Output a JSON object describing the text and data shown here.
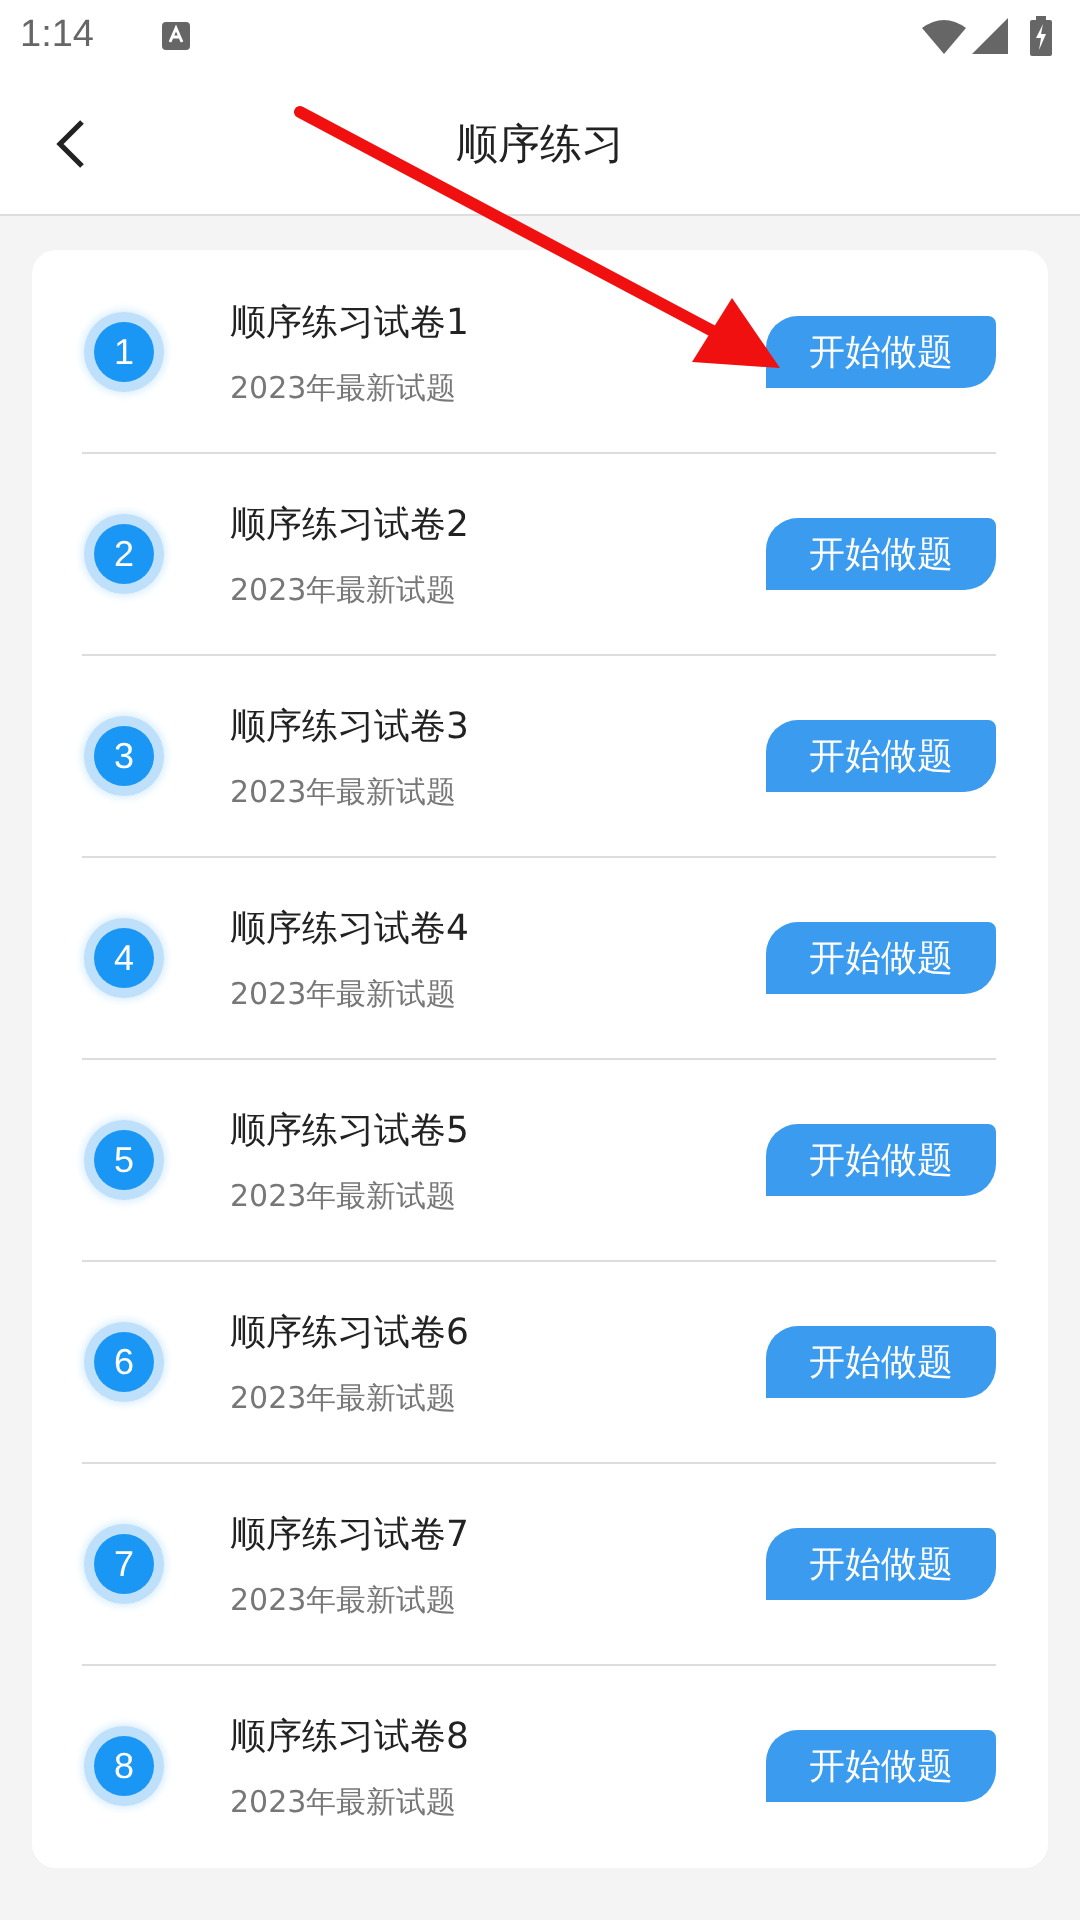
{
  "status_bar": {
    "time": "1:14"
  },
  "header": {
    "title": "顺序练习"
  },
  "papers": [
    {
      "number": "1",
      "title": "顺序练习试卷1",
      "subtitle": "2023年最新试题",
      "button": "开始做题"
    },
    {
      "number": "2",
      "title": "顺序练习试卷2",
      "subtitle": "2023年最新试题",
      "button": "开始做题"
    },
    {
      "number": "3",
      "title": "顺序练习试卷3",
      "subtitle": "2023年最新试题",
      "button": "开始做题"
    },
    {
      "number": "4",
      "title": "顺序练习试卷4",
      "subtitle": "2023年最新试题",
      "button": "开始做题"
    },
    {
      "number": "5",
      "title": "顺序练习试卷5",
      "subtitle": "2023年最新试题",
      "button": "开始做题"
    },
    {
      "number": "6",
      "title": "顺序练习试卷6",
      "subtitle": "2023年最新试题",
      "button": "开始做题"
    },
    {
      "number": "7",
      "title": "顺序练习试卷7",
      "subtitle": "2023年最新试题",
      "button": "开始做题"
    },
    {
      "number": "8",
      "title": "顺序练习试卷8",
      "subtitle": "2023年最新试题",
      "button": "开始做题"
    }
  ]
}
